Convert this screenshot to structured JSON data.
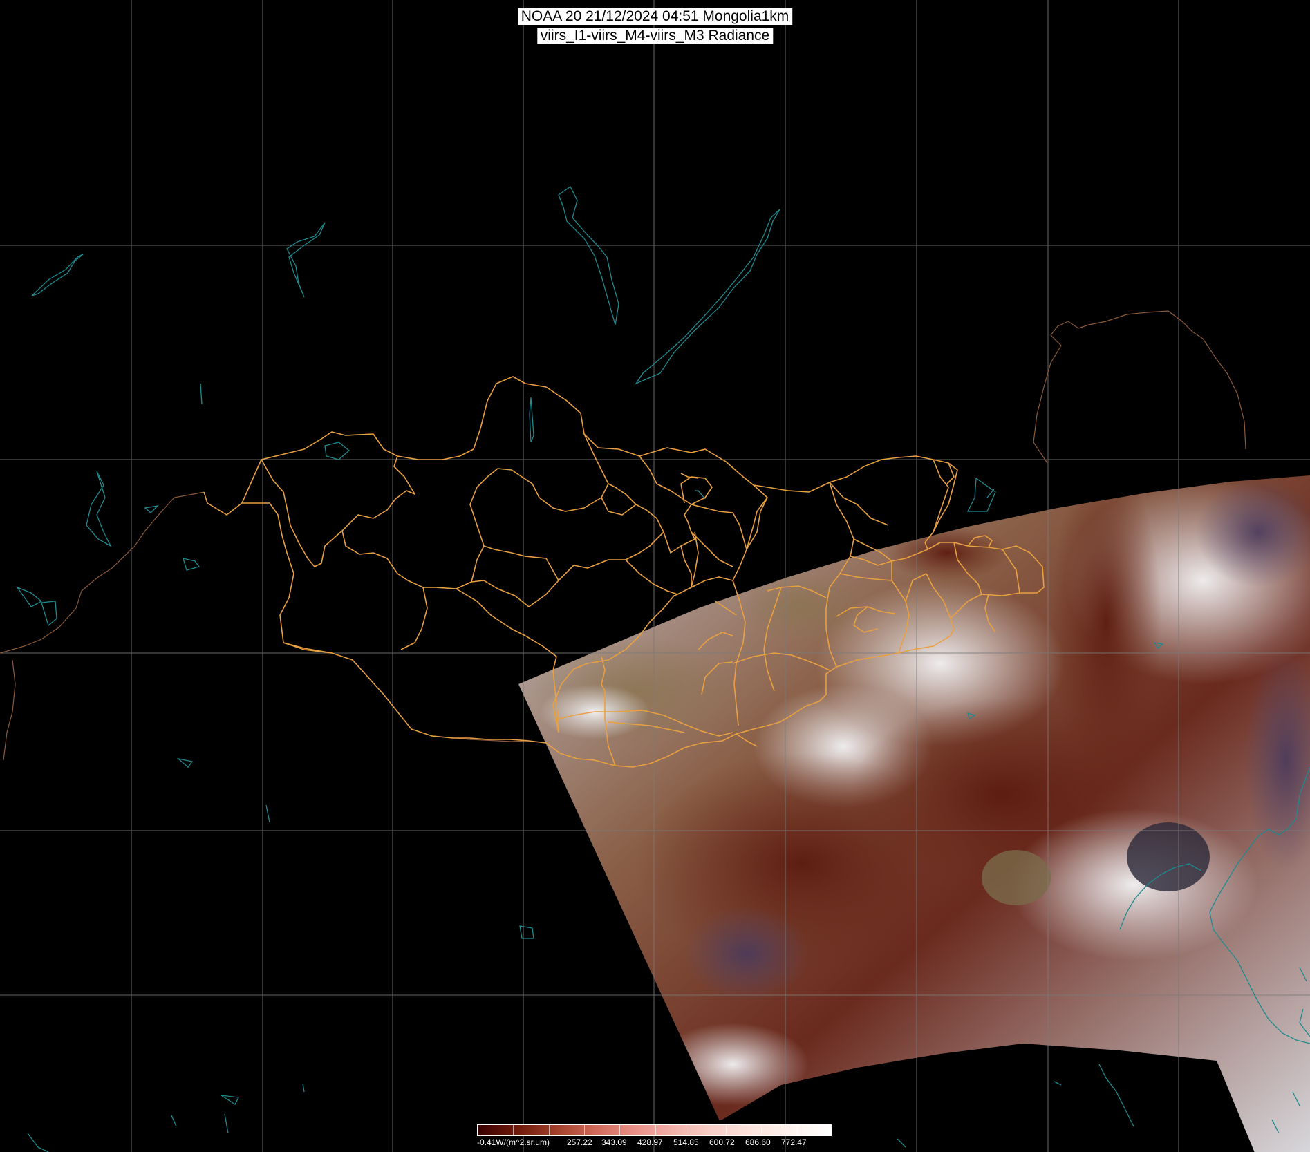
{
  "header": {
    "line1": "NOAA 20 21/12/2024 04:51 Mongolia1km",
    "line2": "viirs_I1-viirs_M4-viirs_M3 Radiance"
  },
  "colorbar": {
    "ticks": [
      "-0.41W/(m^2.sr.um)",
      "257.22",
      "343.09",
      "428.97",
      "514.85",
      "600.72",
      "686.60",
      "772.47"
    ],
    "colors": [
      "#3a0000",
      "#6e1a0a",
      "#a0402a",
      "#d06a5a",
      "#e89088",
      "#f2b2aa",
      "#f8d0c8",
      "#fce4de",
      "#fef2ee",
      "#ffffff"
    ]
  },
  "colors": {
    "background": "#000000",
    "grid": "#7a7a7a",
    "admin_border": "#e8a040",
    "coastline": "#1f8a8f",
    "country_border": "#8a5a3a"
  }
}
